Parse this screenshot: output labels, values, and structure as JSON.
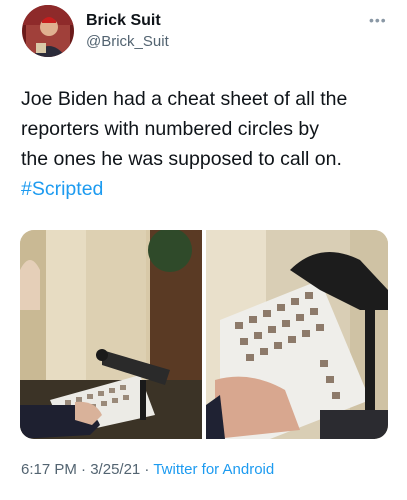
{
  "author": {
    "display_name": "Brick Suit",
    "handle": "@Brick_Suit"
  },
  "more_icon": "more-horizontal-icon",
  "tweet": {
    "text_lines": [
      "Joe Biden had a cheat sheet of all the",
      "reporters with numbered circles by",
      "the ones he was supposed to call on."
    ],
    "hashtag": "#Scripted"
  },
  "meta": {
    "time": "6:17 PM",
    "sep1": " · ",
    "date": "3/25/21",
    "sep2": " · ",
    "source": "Twitter for Android"
  },
  "colors": {
    "link": "#1d9bf0",
    "secondary_text": "#536471"
  }
}
